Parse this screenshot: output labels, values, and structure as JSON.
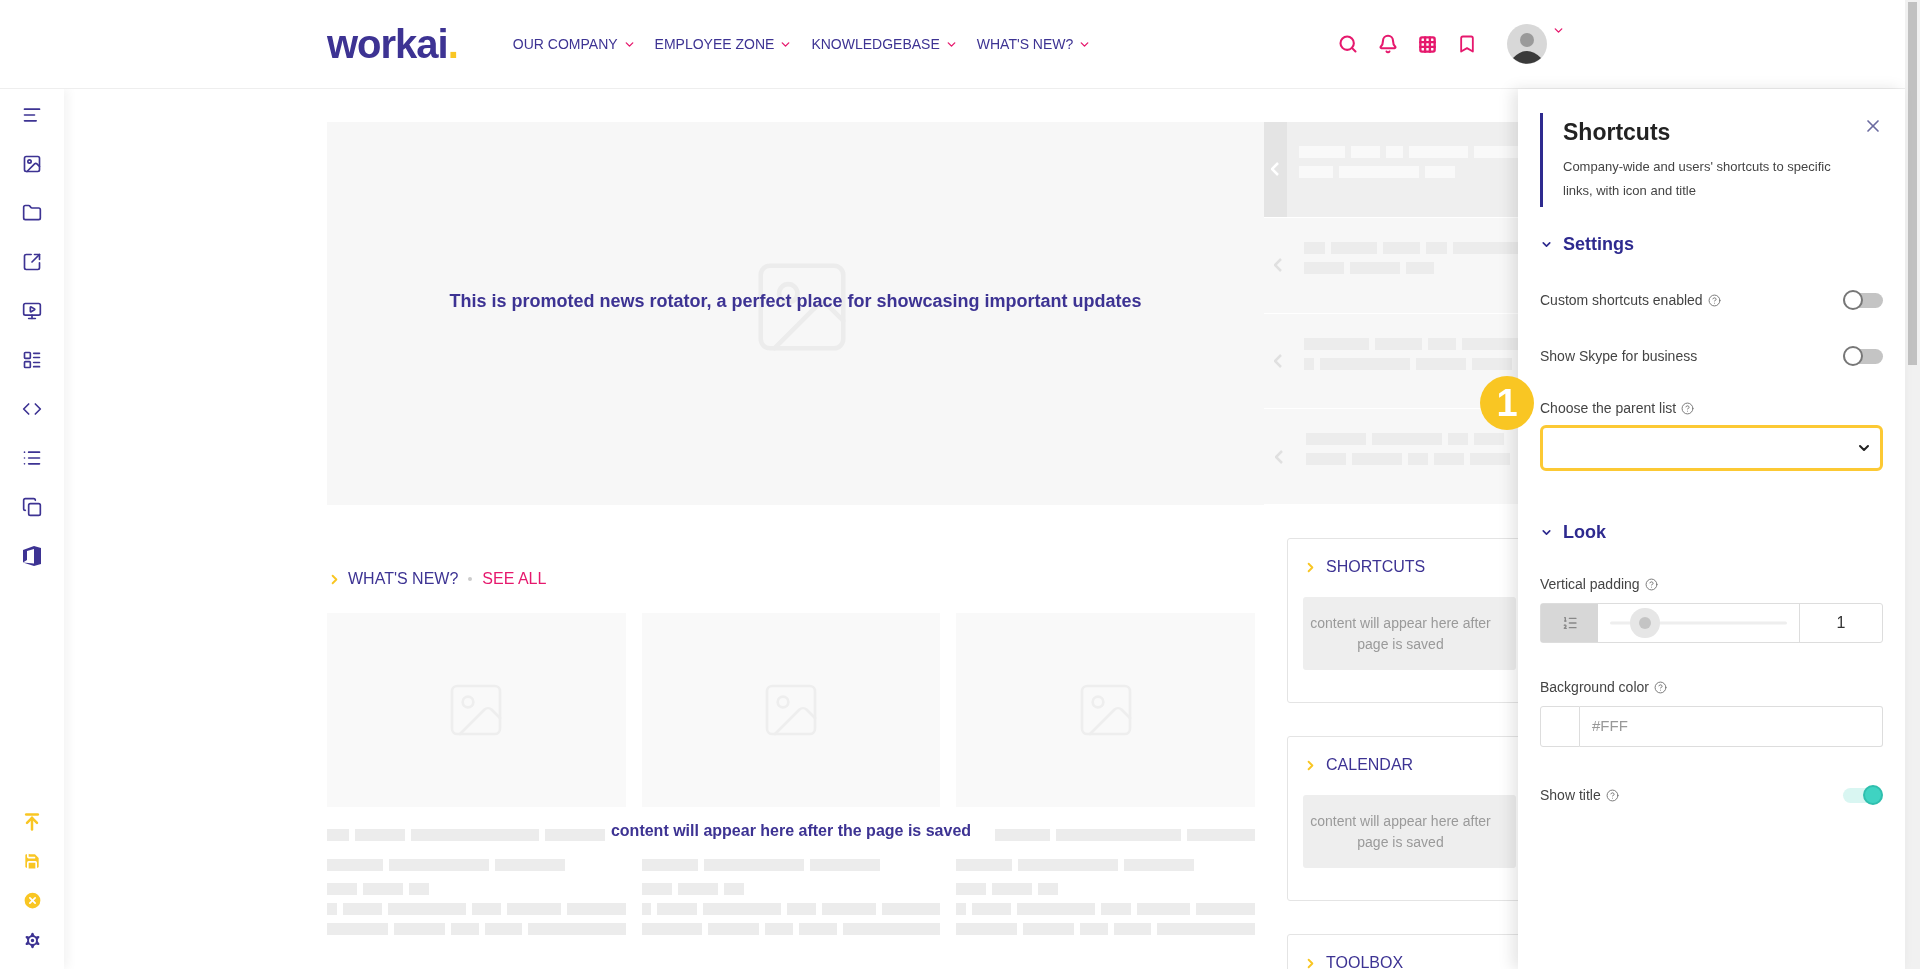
{
  "header": {
    "logo": "workai",
    "logo_dot": ".",
    "nav": [
      {
        "label": "OUR COMPANY"
      },
      {
        "label": "EMPLOYEE ZONE"
      },
      {
        "label": "KNOWLEDGEBASE"
      },
      {
        "label": "WHAT'S NEW?"
      }
    ]
  },
  "rotator": {
    "message": "This is promoted news rotator, a perfect place for showcasing important updates",
    "slides": [
      {
        "selected": true
      },
      {
        "selected": false
      },
      {
        "selected": false
      },
      {
        "selected": false
      }
    ]
  },
  "whats_new": {
    "title": "WHAT'S NEW?",
    "link": "SEE ALL",
    "message": "content will appear here after the page is saved",
    "cards": [
      {
        "kind": "placeholder"
      },
      {
        "kind": "placeholder"
      },
      {
        "kind": "placeholder"
      }
    ]
  },
  "widgets": [
    {
      "title": "SHORTCUTS",
      "message_lines": [
        "content will appear here after",
        "page is saved"
      ]
    },
    {
      "title": "CALENDAR",
      "message_lines": [
        "content will appear here after",
        "page is saved"
      ]
    },
    {
      "title": "TOOLBOX"
    }
  ],
  "panel": {
    "title": "Shortcuts",
    "description": "Company-wide and users' shortcuts to specific links, with icon and title",
    "sections": [
      {
        "title": "Settings",
        "expanded": true,
        "fields": [
          {
            "kind": "toggle",
            "label": "Custom shortcuts enabled",
            "help": true,
            "on": false
          },
          {
            "kind": "toggle",
            "label": "Show Skype for business",
            "help": false,
            "on": false
          },
          {
            "kind": "select",
            "label": "Choose the parent list",
            "help": true,
            "highlighted": true,
            "callout": "1"
          }
        ]
      },
      {
        "title": "Look",
        "expanded": true,
        "fields": [
          {
            "kind": "slider",
            "label": "Vertical padding",
            "help": true,
            "level": 0.2,
            "value": "1"
          },
          {
            "kind": "color",
            "label": "Background color",
            "help": true,
            "placeholder": "#FFF"
          },
          {
            "kind": "toggle",
            "label": "Show title",
            "help": true,
            "on": true
          }
        ]
      }
    ]
  }
}
